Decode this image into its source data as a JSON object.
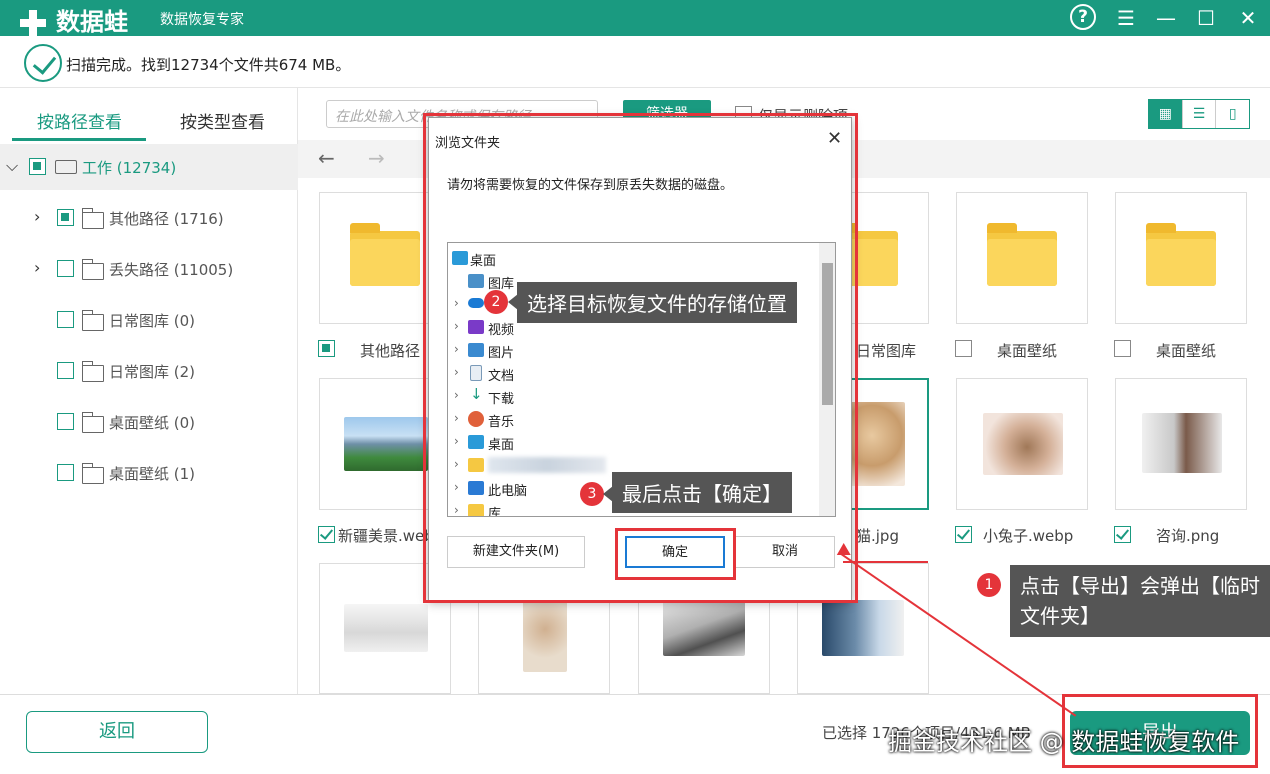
{
  "app": {
    "name": "数据蛙",
    "tagline": "数据恢复专家"
  },
  "window_controls": {
    "help": "?",
    "menu": "☰",
    "minimize": "—",
    "maximize": "☐",
    "close": "✕"
  },
  "status": {
    "text": "扫描完成。找到12734个文件共674 MB。"
  },
  "tabs": [
    {
      "label": "按路径查看"
    },
    {
      "label": "按类型查看"
    }
  ],
  "tree": [
    {
      "label": "工作 (12734)"
    },
    {
      "label": "其他路径 (1716)"
    },
    {
      "label": "丢失路径 (11005)"
    },
    {
      "label": "日常图库 (0)"
    },
    {
      "label": "日常图库 (2)"
    },
    {
      "label": "桌面壁纸 (0)"
    },
    {
      "label": "桌面壁纸 (1)"
    }
  ],
  "toolbar": {
    "search_placeholder": "在此处输入文件名称或保存路径",
    "filter_label": "筛选器",
    "deleted_only_label": "仅显示删除项"
  },
  "grid": {
    "row1": [
      {
        "label": "其他路径"
      },
      {
        "label": "日常图库"
      },
      {
        "label": "桌面壁纸"
      },
      {
        "label": "桌面壁纸"
      }
    ],
    "row2": [
      {
        "label": "新疆美景.webp"
      },
      {
        "label": "猫.jpg"
      },
      {
        "label": "小兔子.webp"
      },
      {
        "label": "咨询.png"
      }
    ]
  },
  "footer": {
    "back_label": "返回",
    "selected_info": "已选择 1726个项目/431.6 MB",
    "export_label": "导出"
  },
  "dialog": {
    "title": "浏览文件夹",
    "message": "请勿将需要恢复的文件保存到原丢失数据的磁盘。",
    "tree_items": [
      {
        "label": "桌面"
      },
      {
        "label": "图库"
      },
      {
        "label": ""
      },
      {
        "label": "视频"
      },
      {
        "label": "图片"
      },
      {
        "label": "文档"
      },
      {
        "label": "下载"
      },
      {
        "label": "音乐"
      },
      {
        "label": "桌面"
      },
      {
        "label": ""
      },
      {
        "label": "此电脑"
      },
      {
        "label": "库"
      }
    ],
    "new_folder_label": "新建文件夹(M)",
    "ok_label": "确定",
    "cancel_label": "取消"
  },
  "annotations": [
    {
      "num": "1",
      "text": "点击【导出】会弹出【临时文件夹】"
    },
    {
      "num": "2",
      "text": "选择目标恢复文件的存储位置"
    },
    {
      "num": "3",
      "text": "最后点击【确定】"
    }
  ],
  "watermark": "掘金技术社区 @ 数据蛙恢复软件",
  "colors": {
    "accent": "#1a9a80",
    "annotation_red": "#e4343a",
    "folder": "#f5c842"
  }
}
